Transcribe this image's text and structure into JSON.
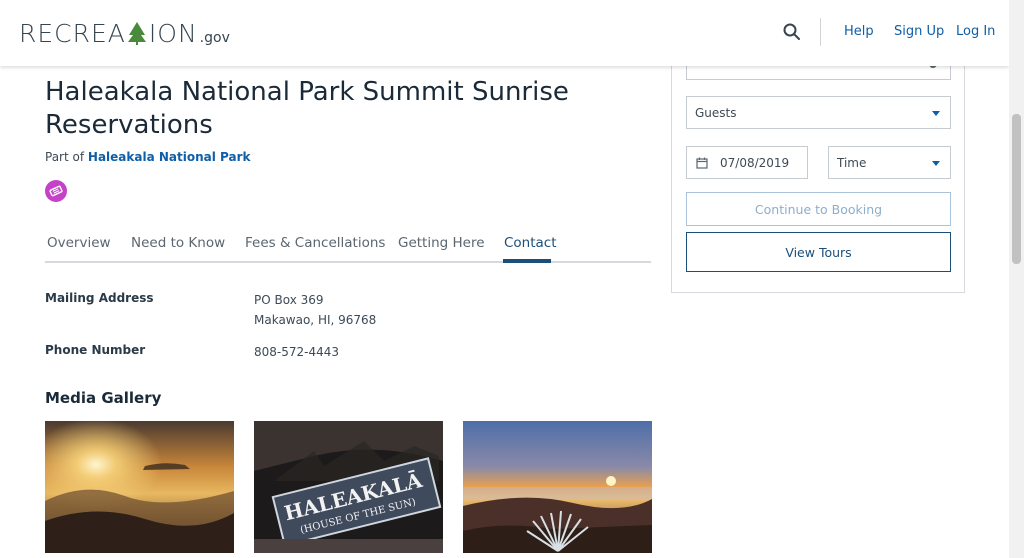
{
  "header": {
    "logo_main": "RECREATION",
    "logo_suffix": ".gov",
    "nav": {
      "help": "Help",
      "sign_up": "Sign Up",
      "log_in": "Log In"
    }
  },
  "page": {
    "title": "Haleakala National Park Summit Sunrise Reservations",
    "part_of_prefix": "Part of",
    "part_of_link": "Haleakala National Park"
  },
  "tabs": [
    {
      "label": "Overview"
    },
    {
      "label": "Need to Know"
    },
    {
      "label": "Fees & Cancellations"
    },
    {
      "label": "Getting Here"
    },
    {
      "label": "Contact",
      "active": true
    }
  ],
  "contact": {
    "mailing_label": "Mailing Address",
    "mailing_line1": "PO Box 369",
    "mailing_line2": "Makawao, HI, 96768",
    "phone_label": "Phone Number",
    "phone_value": "808-572-4443"
  },
  "gallery": {
    "title": "Media Gallery"
  },
  "booking": {
    "guests_label": "Guests",
    "date_value": "07/08/2019",
    "time_label": "Time",
    "continue_label": "Continue to Booking",
    "view_tours_label": "View Tours"
  },
  "colors": {
    "link": "#0e5ea8",
    "primary_dark": "#1b4f7a",
    "badge": "#c542c8"
  }
}
